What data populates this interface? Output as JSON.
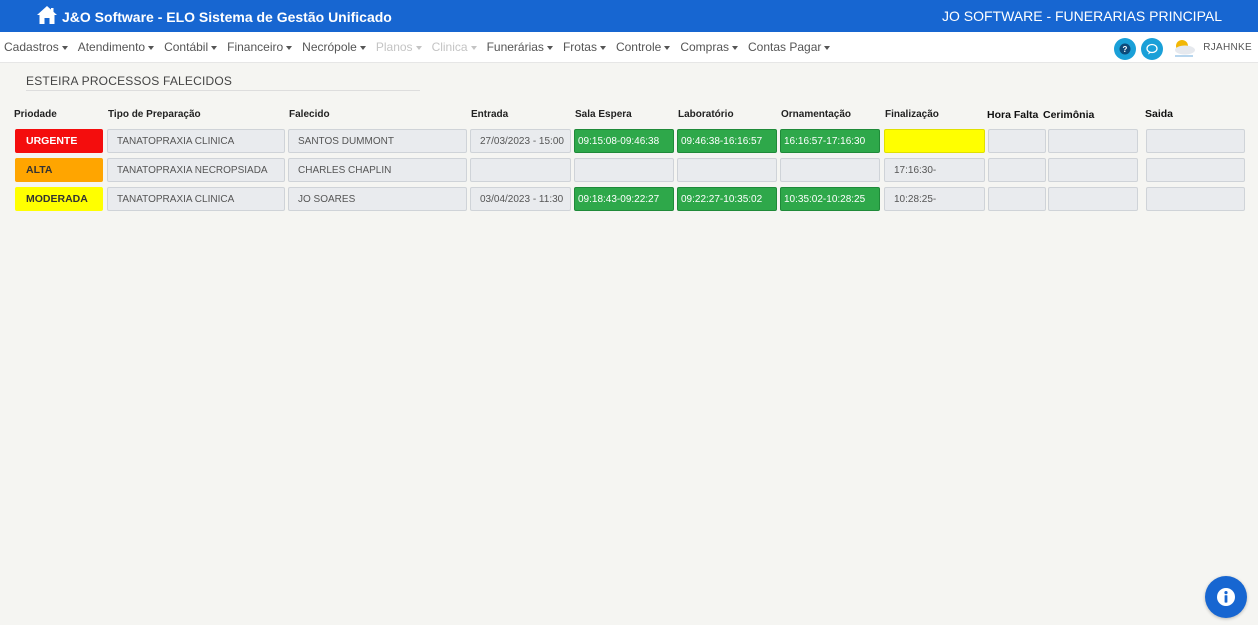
{
  "header": {
    "title": "J&O Software - ELO Sistema de Gestão Unificado",
    "company": "JO SOFTWARE - FUNERARIAS PRINCIPAL",
    "bg_color": "#1766d1"
  },
  "menu": [
    {
      "label": "Cadastros",
      "enabled": true
    },
    {
      "label": "Atendimento",
      "enabled": true
    },
    {
      "label": "Contábil",
      "enabled": true
    },
    {
      "label": "Financeiro",
      "enabled": true
    },
    {
      "label": "Necrópole",
      "enabled": true
    },
    {
      "label": "Planos",
      "enabled": false
    },
    {
      "label": "Clinica",
      "enabled": false
    },
    {
      "label": "Funerárias",
      "enabled": true
    },
    {
      "label": "Frotas",
      "enabled": true
    },
    {
      "label": "Controle",
      "enabled": true
    },
    {
      "label": "Compras",
      "enabled": true
    },
    {
      "label": "Contas Pagar",
      "enabled": true
    }
  ],
  "toolbar": {
    "icons": [
      "help-icon",
      "chat-icon",
      "cloud-icon"
    ],
    "username": "RJAHNKE"
  },
  "section": {
    "title": "ESTEIRA PROCESSOS FALECIDOS"
  },
  "table": {
    "columns": [
      "Priodade",
      "Tipo de Preparação",
      "Falecido",
      "Entrada",
      "Sala Espera",
      "Laboratório",
      "Ornamentação",
      "Finalização",
      "Hora Falta",
      "Cerimônia",
      "Saida"
    ],
    "rows": [
      {
        "priority": "URGENTE",
        "priority_color": "#f40d0d",
        "priority_text_color": "#ffffff",
        "tipo": "TANATOPRAXIA CLINICA",
        "falecido": "SANTOS DUMMONT",
        "entrada": "27/03/2023 - 15:00",
        "sala_espera": "09:15:08-09:46:38",
        "laboratorio": "09:46:38-16:16:57",
        "ornamentacao": "16:16:57-17:16:30",
        "finalizacao": "",
        "finalizacao_color": "#ffff00",
        "hora_falta": "",
        "cerimonia": "",
        "saida": ""
      },
      {
        "priority": "ALTA",
        "priority_color": "#ffa500",
        "priority_text_color": "#333333",
        "tipo": "TANATOPRAXIA NECROPSIADA",
        "falecido": "CHARLES CHAPLIN",
        "entrada": "",
        "sala_espera": "",
        "laboratorio": "",
        "ornamentacao": "",
        "finalizacao": "17:16:30-",
        "finalizacao_color": "",
        "hora_falta": "",
        "cerimonia": "",
        "saida": ""
      },
      {
        "priority": "MODERADA",
        "priority_color": "#ffff00",
        "priority_text_color": "#333333",
        "tipo": "TANATOPRAXIA CLINICA",
        "falecido": "JO SOARES",
        "entrada": "03/04/2023 - 11:30",
        "sala_espera": "09:18:43-09:22:27",
        "laboratorio": "09:22:27-10:35:02",
        "ornamentacao": "10:35:02-10:28:25",
        "finalizacao": "10:28:25-",
        "finalizacao_color": "",
        "hora_falta": "",
        "cerimonia": "",
        "saida": ""
      }
    ],
    "stage_color_done": "#2ea84a"
  },
  "fab": {
    "icon": "info-icon",
    "color": "#1766d1"
  }
}
